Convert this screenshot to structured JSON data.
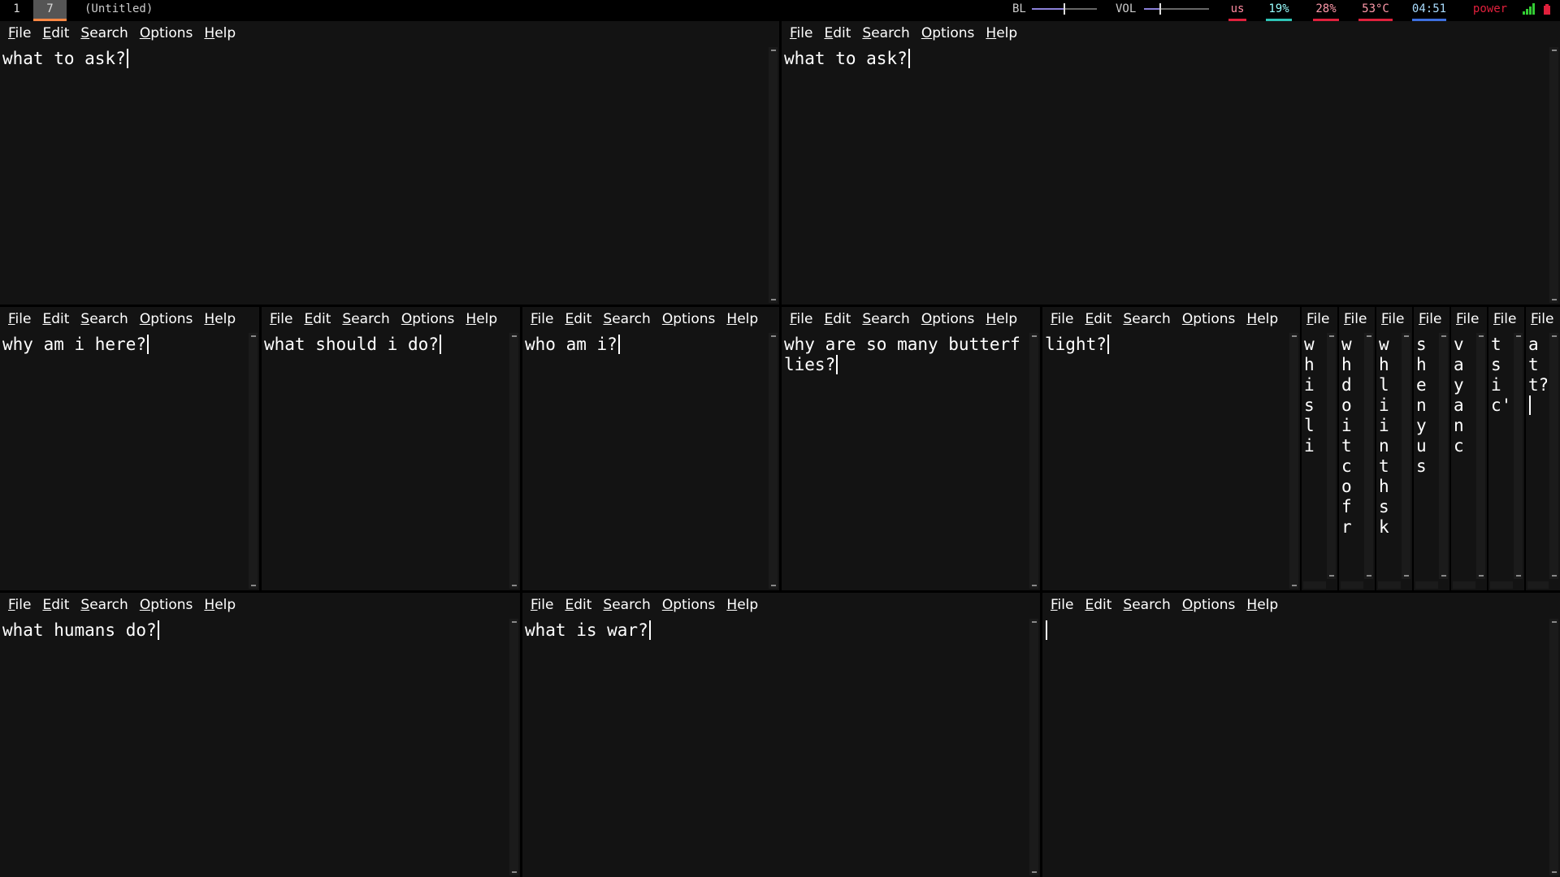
{
  "topbar": {
    "workspaces": [
      {
        "label": "1",
        "active": false
      },
      {
        "label": "7",
        "active": true
      }
    ],
    "window_title": "(Untitled)",
    "bl_label": "BL",
    "vol_label": "VOL",
    "bl_level": 0.5,
    "vol_level": 0.25,
    "keyboard_layout": "us",
    "cpu": "19%",
    "mem": "28%",
    "temp": "53°C",
    "clock": "04:51",
    "power_label": "power",
    "colors": {
      "cpu": "#2ec4b6",
      "mem": "#e0203c",
      "temp": "#e0203c",
      "clock": "#3d6fe0",
      "layout": "#e0203c",
      "power": "#e0203c"
    }
  },
  "menu": {
    "file": "File",
    "edit": "Edit",
    "search": "Search",
    "options": "Options",
    "help": "Help"
  },
  "editors": {
    "e1": "what to ask?",
    "e2": "what to ask?",
    "e3": "why am i here?",
    "e4": "what should i do?",
    "e5": "who am i?",
    "e6": "why are so many butterflies?",
    "e7": "light?",
    "e8": "wh is li",
    "e9": "wh do it co fr",
    "e10": "wh li in th sk",
    "e11": "s he ny us",
    "e12": "v ay anc",
    "e13": "ts ic'",
    "e14": "at t?",
    "e15": "what humans do?",
    "e16": "what is war?",
    "e17": ""
  }
}
